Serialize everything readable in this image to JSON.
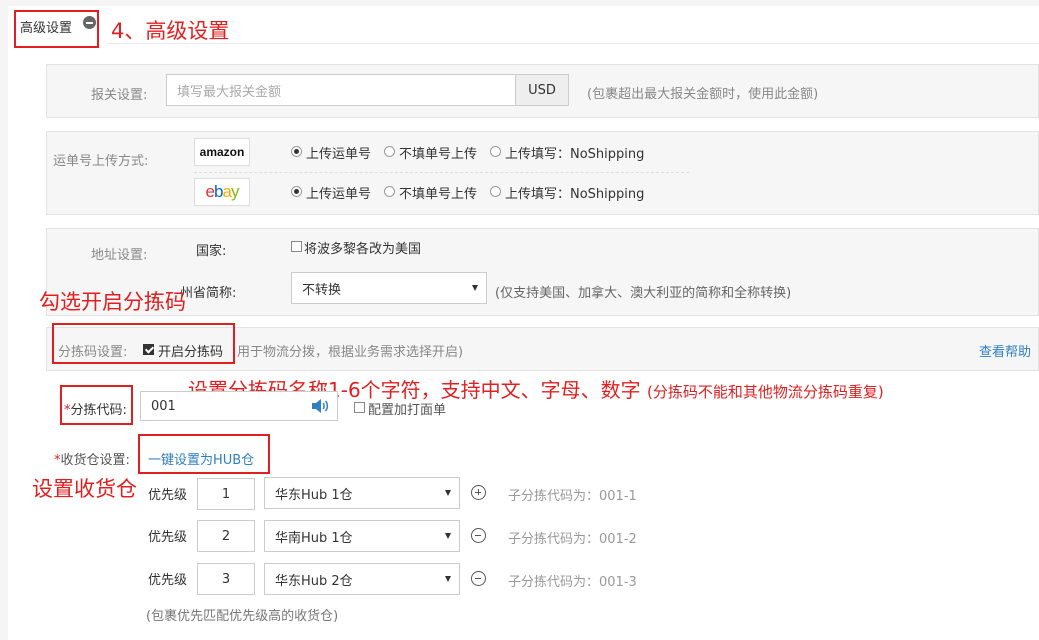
{
  "section": {
    "title": "高级设置",
    "annotation": "4、高级设置"
  },
  "customs": {
    "label": "报关设置:",
    "placeholder": "填写最大报关金额",
    "currency": "USD",
    "hint": "(包裹超出最大报关金额时，使用此金额)"
  },
  "tracking": {
    "label": "运单号上传方式:",
    "platforms": [
      {
        "name": "amazon",
        "options": [
          "上传运单号",
          "不填单号上传",
          "上传填写：NoShipping"
        ],
        "selected_index": 0
      },
      {
        "name": "ebay",
        "options": [
          "上传运单号",
          "不填单号上传",
          "上传填写：NoShipping"
        ],
        "selected_index": 0
      }
    ]
  },
  "address": {
    "label": "地址设置:",
    "country_label": "国家:",
    "country_checkbox": "将波多黎各改为美国",
    "country_checked": false,
    "state_label": "州省简称:",
    "state_value": "不转换",
    "state_hint": "(仅支持美国、加拿大、澳大利亚的简称和全称转换)"
  },
  "sorting": {
    "annotation": "勾选开启分拣码",
    "label": "分拣码设置:",
    "checkbox_label": "开启分拣码",
    "checked": true,
    "hint": "用于物流分拨，根据业务需求选择开启)",
    "help_link": "查看帮助",
    "code_annotation": "设置分拣码名称1-6个字符，支持中文、字母、数字",
    "code_annotation_small": "(分拣码不能和其他物流分拣码重复)",
    "code_label": "分拣代码:",
    "code_value": "001",
    "print_label": "配置加打面单",
    "print_checked": false
  },
  "warehouse": {
    "label": "收货仓设置:",
    "hub_link": "一键设置为HUB仓",
    "annotation": "设置收货仓",
    "priority_label": "优先级",
    "rows": [
      {
        "priority": "1",
        "warehouse": "华东Hub 1仓",
        "action": "add",
        "sub_code": "子分拣代码为：001-1"
      },
      {
        "priority": "2",
        "warehouse": "华南Hub 1仓",
        "action": "remove",
        "sub_code": "子分拣代码为：001-2"
      },
      {
        "priority": "3",
        "warehouse": "华东Hub 2仓",
        "action": "remove",
        "sub_code": "子分拣代码为：001-3"
      }
    ],
    "footer_hint": "(包裹优先匹配优先级高的收货仓)"
  },
  "colors": {
    "annotation_red": "#e02020",
    "link_blue": "#2f7fc1",
    "amazon_text": "#111111",
    "ebay_e": "#e53238",
    "ebay_b": "#0064d2",
    "ebay_a": "#f5af02",
    "ebay_y": "#86b817"
  }
}
